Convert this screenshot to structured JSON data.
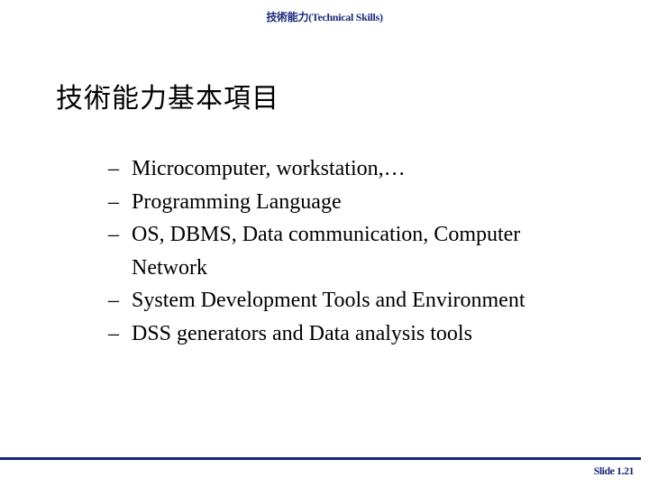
{
  "header": {
    "title": "技術能力(Technical Skills)"
  },
  "slide": {
    "title": "技術能力基本項目",
    "bullet_marker": "–",
    "bullets": [
      {
        "text": "Microcomputer, workstation,…",
        "continuation": ""
      },
      {
        "text": "Programming Language",
        "continuation": ""
      },
      {
        "text": "OS, DBMS, Data communication, Computer",
        "continuation": "Network"
      },
      {
        "text": "System Development Tools and Environment",
        "continuation": ""
      },
      {
        "text": "DSS generators and Data analysis tools",
        "continuation": ""
      }
    ]
  },
  "footer": {
    "slide_number": "Slide 1.21"
  },
  "colors": {
    "accent": "#15287a",
    "text": "#000000",
    "background": "#ffffff"
  }
}
